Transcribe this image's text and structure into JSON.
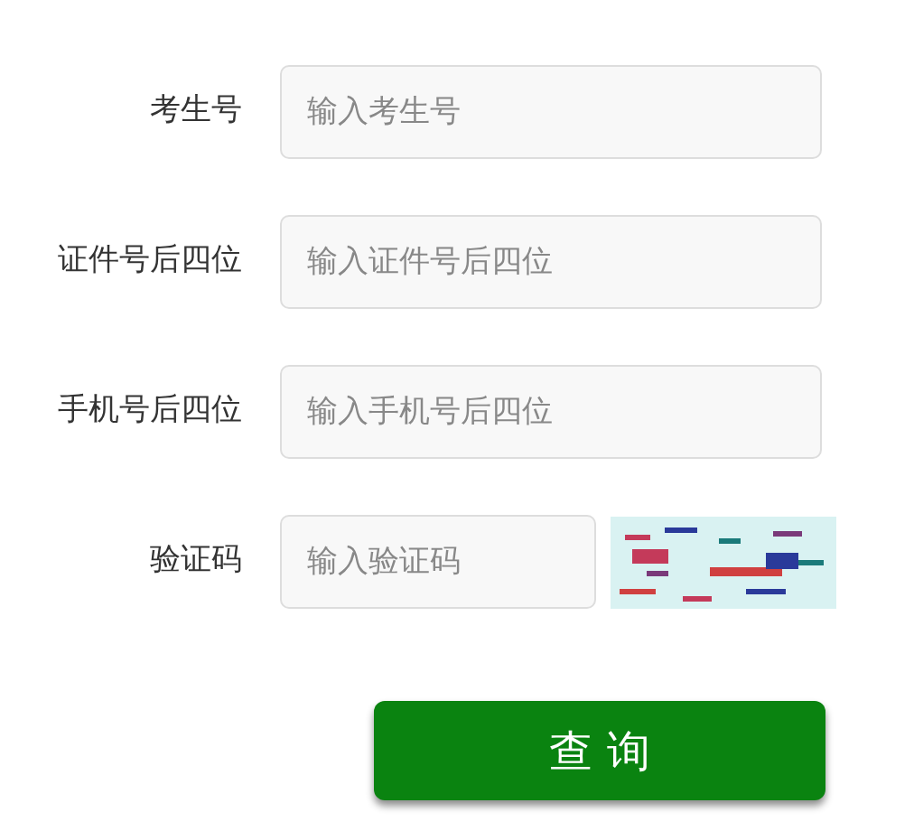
{
  "fields": [
    {
      "label": "考生号",
      "placeholder": "输入考生号",
      "kind": "text"
    },
    {
      "label": "证件号后四位",
      "placeholder": "输入证件号后四位",
      "kind": "text"
    },
    {
      "label": "手机号后四位",
      "placeholder": "输入手机号后四位",
      "kind": "text"
    },
    {
      "label": "验证码",
      "placeholder": "输入验证码",
      "kind": "captcha"
    }
  ],
  "submit_button": "查 询"
}
